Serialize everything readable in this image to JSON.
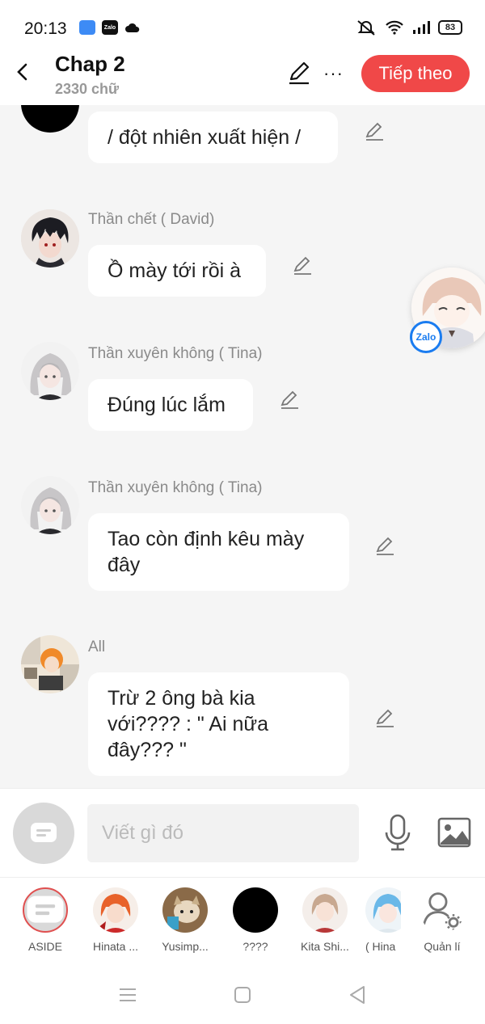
{
  "status_bar": {
    "time": "20:13",
    "battery": "83"
  },
  "header": {
    "title": "Chap 2",
    "subtitle": "2330 chữ",
    "next_label": "Tiếp theo"
  },
  "messages": [
    {
      "sender": "",
      "text": "/ đột nhiên xuất hiện /",
      "avatar": "black"
    },
    {
      "sender": "Thần chết ( David)",
      "text": "Ồ mày tới rồi à",
      "avatar": "david"
    },
    {
      "sender": "Thần xuyên không ( Tina)",
      "text": "Đúng lúc lắm",
      "avatar": "tina"
    },
    {
      "sender": "Thần xuyên không ( Tina)",
      "text": "Tao còn định kêu mày đây",
      "avatar": "tina"
    },
    {
      "sender": "All",
      "text": "Trừ 2 ông bà kia với???? : \" Ai nữa đây??? \"",
      "avatar": "all"
    }
  ],
  "floating": {
    "badge": "Zalo"
  },
  "input": {
    "placeholder": "Viết gì đó"
  },
  "characters": [
    {
      "label": "ASIDE"
    },
    {
      "label": "Hinata ..."
    },
    {
      "label": "Yusimp..."
    },
    {
      "label": "????"
    },
    {
      "label": "Kita Shi..."
    },
    {
      "label": "( Hina"
    },
    {
      "label": "Quản lí"
    }
  ]
}
